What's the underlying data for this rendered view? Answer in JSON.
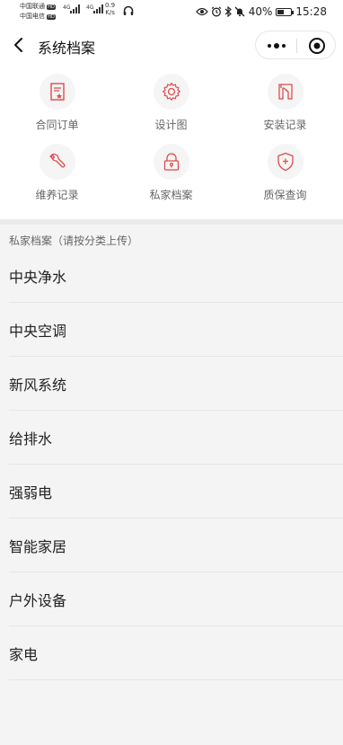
{
  "status_bar": {
    "carrier1": "中国联通",
    "carrier2": "中国电信",
    "hd1": "HD",
    "hd2": "HD",
    "net1": "4G",
    "net2": "4G",
    "speed_value": "0.9",
    "speed_unit": "K/s",
    "battery_text": "40%",
    "battery_level": 0.4,
    "time": "15:28"
  },
  "nav": {
    "title": "系统档案"
  },
  "accent_color": "#e04a4a",
  "grid": {
    "items": [
      {
        "label": "合同订单",
        "icon": "contract-icon"
      },
      {
        "label": "设计图",
        "icon": "gear-icon"
      },
      {
        "label": "安装记录",
        "icon": "install-icon"
      },
      {
        "label": "维养记录",
        "icon": "wrench-icon"
      },
      {
        "label": "私家档案",
        "icon": "lock-icon"
      },
      {
        "label": "质保查询",
        "icon": "shield-icon"
      }
    ]
  },
  "section": {
    "title": "私家档案（请按分类上传）"
  },
  "list": {
    "items": [
      {
        "label": "中央净水"
      },
      {
        "label": "中央空调"
      },
      {
        "label": "新风系统"
      },
      {
        "label": "给排水"
      },
      {
        "label": "强弱电"
      },
      {
        "label": "智能家居"
      },
      {
        "label": "户外设备"
      },
      {
        "label": "家电"
      }
    ]
  }
}
